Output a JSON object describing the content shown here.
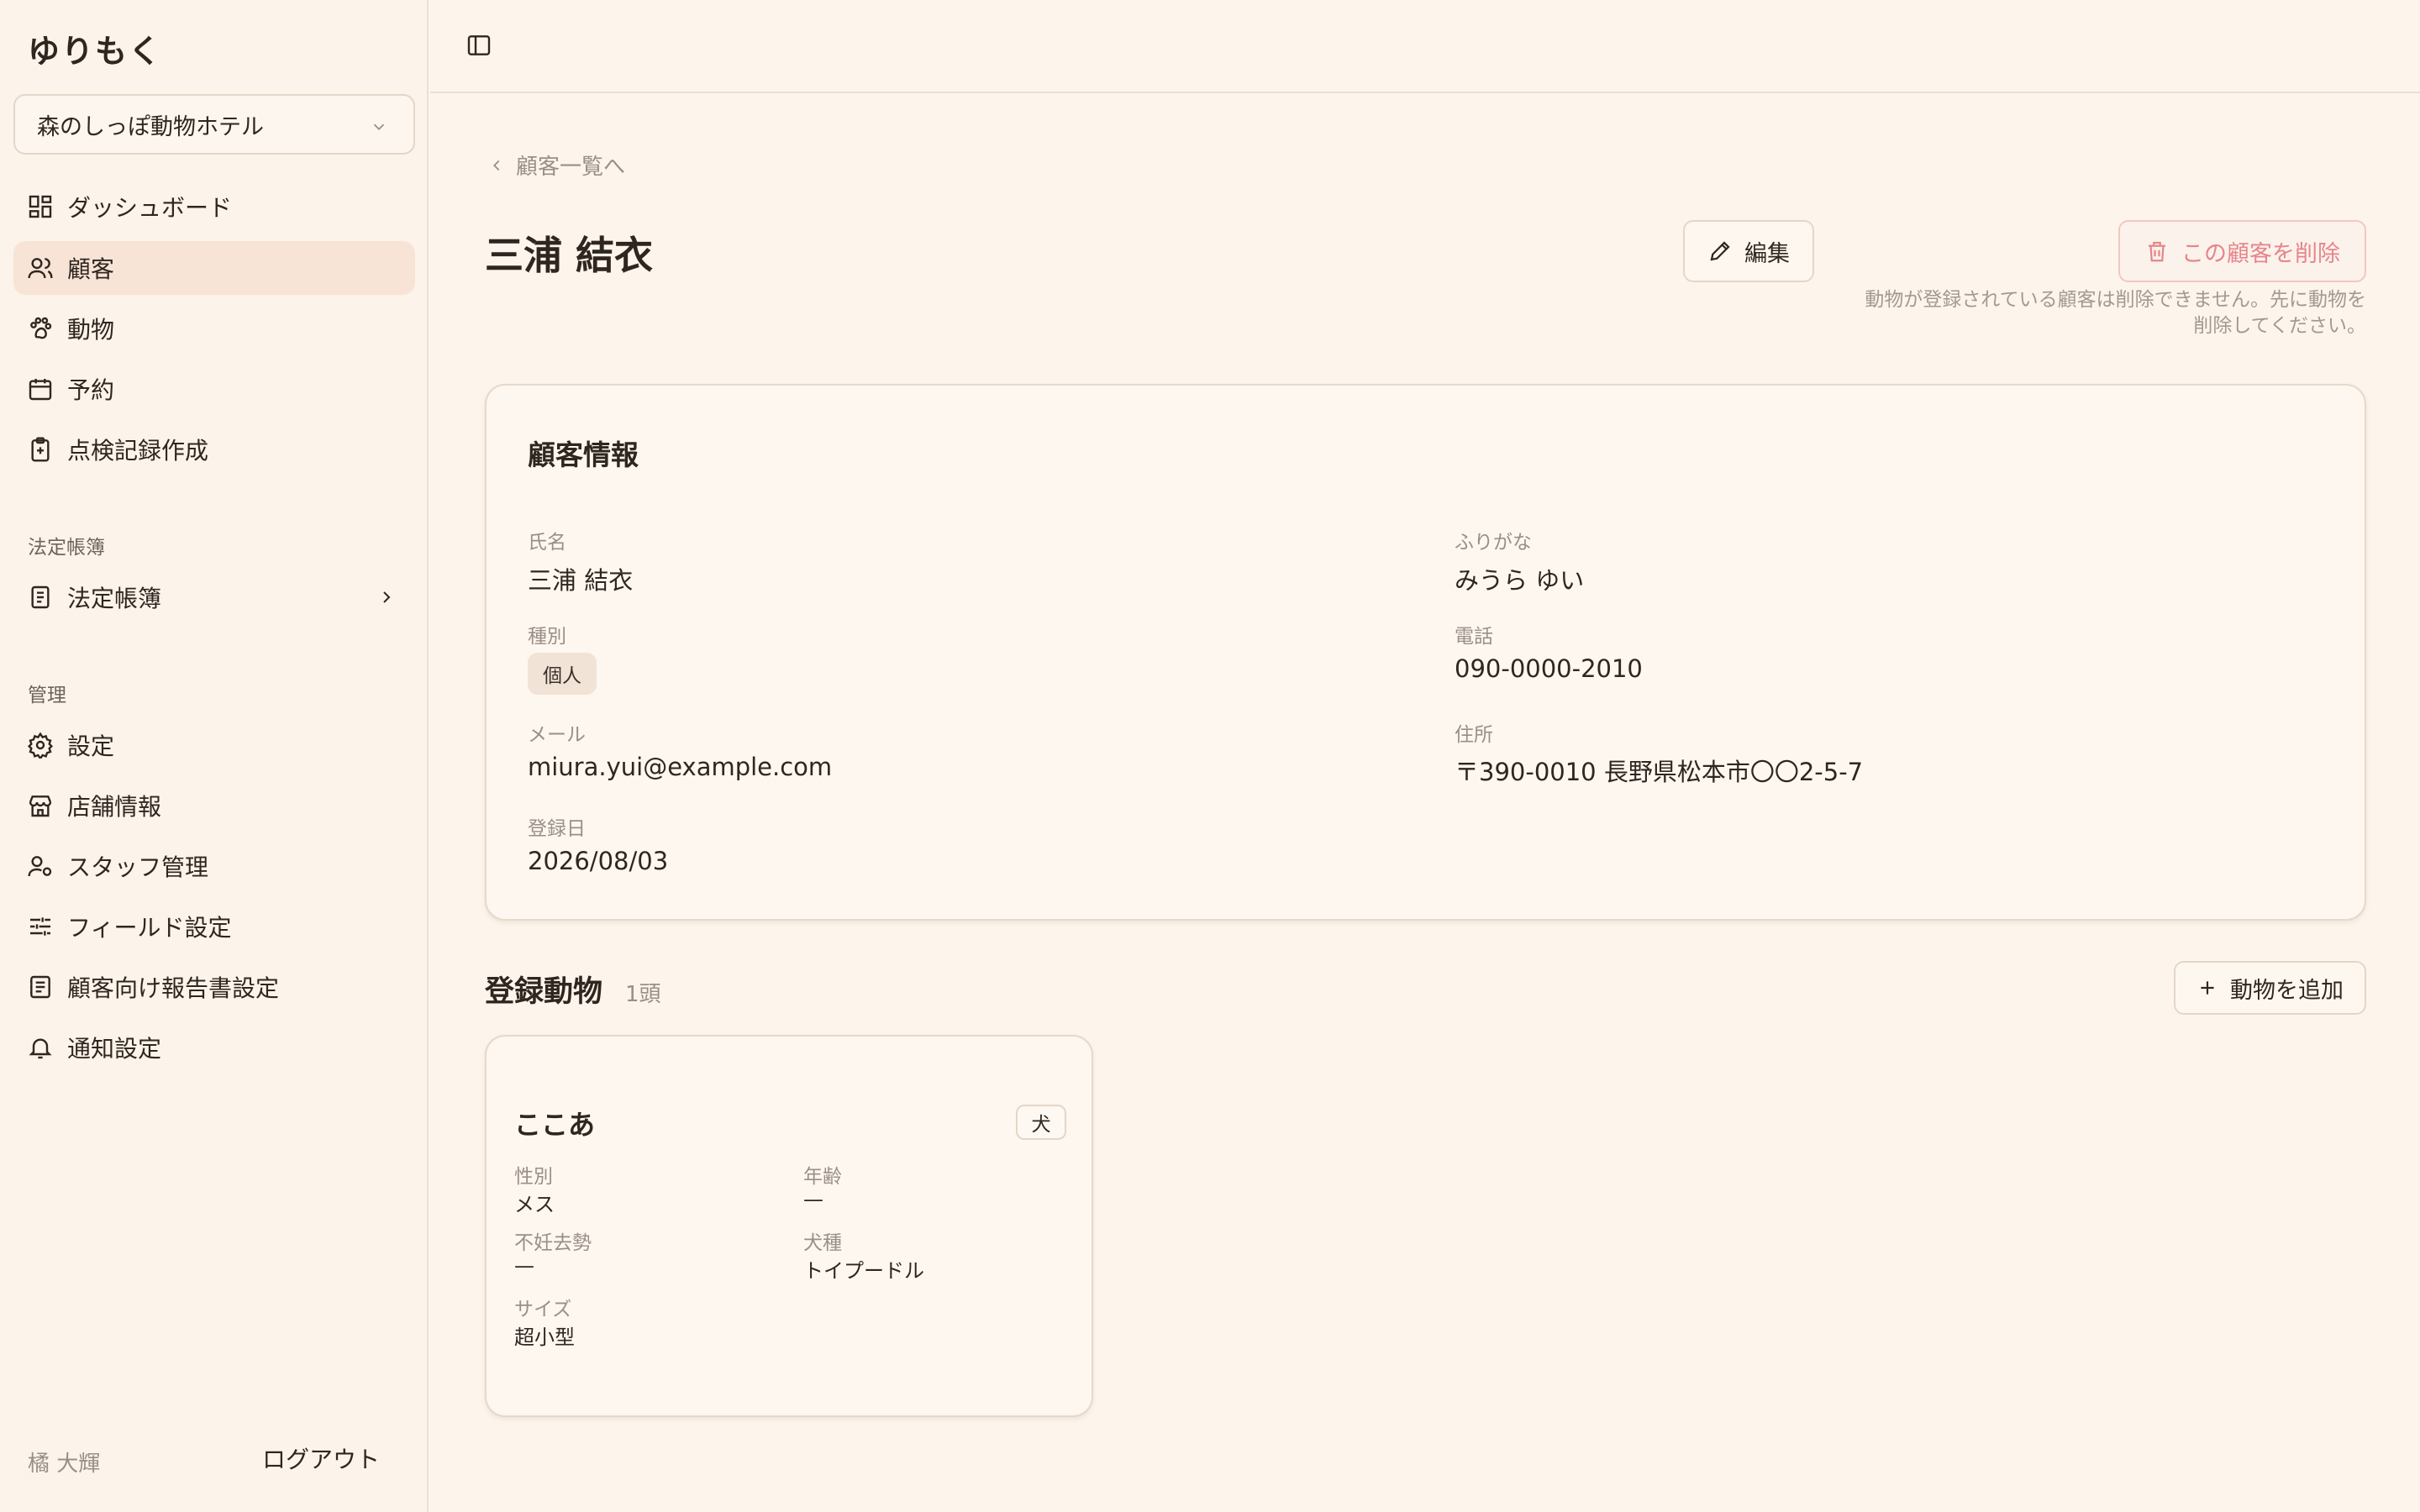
{
  "app": {
    "name": "ゆりもく"
  },
  "store_select": {
    "value": "森のしっぽ動物ホテル"
  },
  "nav": {
    "main": [
      {
        "label": "ダッシュボード",
        "icon": "dashboard-icon"
      },
      {
        "label": "顧客",
        "icon": "users-icon",
        "active": true
      },
      {
        "label": "動物",
        "icon": "paw-icon"
      },
      {
        "label": "予約",
        "icon": "calendar-icon"
      },
      {
        "label": "点検記録作成",
        "icon": "clipboard-plus-icon"
      }
    ],
    "ledger_section": "法定帳簿",
    "ledger_item": {
      "label": "法定帳簿",
      "icon": "book-icon"
    },
    "admin_section": "管理",
    "admin": [
      {
        "label": "設定",
        "icon": "gear-icon"
      },
      {
        "label": "店舗情報",
        "icon": "store-icon"
      },
      {
        "label": "スタッフ管理",
        "icon": "staff-icon"
      },
      {
        "label": "フィールド設定",
        "icon": "sliders-icon"
      },
      {
        "label": "顧客向け報告書設定",
        "icon": "report-icon"
      },
      {
        "label": "通知設定",
        "icon": "bell-icon"
      }
    ]
  },
  "footer": {
    "user": "橘 大輝",
    "logout": "ログアウト"
  },
  "breadcrumb": "顧客一覧へ",
  "page": {
    "title": "三浦 結衣",
    "edit_label": "編集",
    "delete_label": "この顧客を削除",
    "delete_note_line1": "動物が登録されている顧客は削除できません。先に動物を",
    "delete_note_line2": "削除してください。"
  },
  "customer": {
    "section_title": "顧客情報",
    "name_label": "氏名",
    "name": "三浦 結衣",
    "kana_label": "ふりがな",
    "kana": "みうら ゆい",
    "type_label": "種別",
    "type": "個人",
    "phone_label": "電話",
    "phone": "090-0000-2010",
    "email_label": "メール",
    "email": "miura.yui@example.com",
    "address_label": "住所",
    "address": "〒390-0010 長野県松本市〇〇2-5-7",
    "registered_label": "登録日",
    "registered": "2026/08/03"
  },
  "animals": {
    "section_title": "登録動物",
    "count": "1頭",
    "add_label": "動物を追加",
    "items": [
      {
        "name": "ここあ",
        "species": "犬",
        "sex_label": "性別",
        "sex": "メス",
        "age_label": "年齢",
        "age": "—",
        "neuter_label": "不妊去勢",
        "neuter": "—",
        "breed_label": "犬種",
        "breed": "トイプードル",
        "size_label": "サイズ",
        "size": "超小型"
      }
    ]
  },
  "colors": {
    "background": "#fdf5ec",
    "active_nav": "#f7e4d6",
    "danger": "#e6868a",
    "border": "#e6d9cc"
  }
}
